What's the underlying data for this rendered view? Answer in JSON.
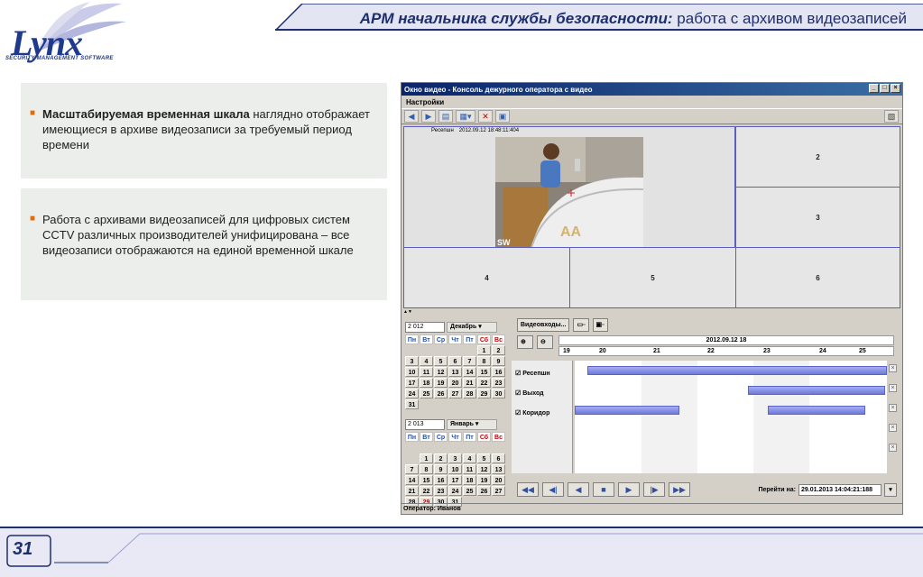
{
  "header": {
    "title_bold": "АРМ начальника службы безопасности:",
    "title_rest": " работа с архивом видеозаписей"
  },
  "logo": {
    "name": "Lynx",
    "tagline": "SECURITY MANAGEMENT SOFTWARE"
  },
  "bullets": {
    "b1_bold": "Масштабируемая временная шкала",
    "b1_rest": " наглядно отображает имеющиеся в архиве видеозаписи за требуемый период времени",
    "b2": "Работа с архивами видеозаписей для цифровых систем CCTV различных производителей унифицирована – все видеозаписи отображаются на  единой временной шкале"
  },
  "window": {
    "title": "Окно видео - Консоль дежурного оператора с видео",
    "menu_settings": "Настройки",
    "cam_name": "Ресепшн",
    "cam_time": "2012.09.12 18:48:11:404",
    "cells": [
      "2",
      "3",
      "4",
      "5",
      "6"
    ],
    "status": "Оператор: Иванов"
  },
  "calendar1": {
    "year": "2 012",
    "month": "Декабрь",
    "headers": [
      "Пн",
      "Вт",
      "Ср",
      "Чт",
      "Пт",
      "Сб",
      "Вс"
    ],
    "days": [
      "",
      "",
      "",
      "",
      "",
      "1",
      "2",
      "3",
      "4",
      "5",
      "6",
      "7",
      "8",
      "9",
      "10",
      "11",
      "12",
      "13",
      "14",
      "15",
      "16",
      "17",
      "18",
      "19",
      "20",
      "21",
      "22",
      "23",
      "24",
      "25",
      "26",
      "27",
      "28",
      "29",
      "30",
      "31"
    ]
  },
  "calendar2": {
    "year": "2 013",
    "month": "Январь",
    "days": [
      "",
      "",
      "",
      "",
      "",
      "",
      "",
      "",
      "1",
      "2",
      "3",
      "4",
      "5",
      "6",
      "7",
      "8",
      "9",
      "10",
      "11",
      "12",
      "13",
      "14",
      "15",
      "16",
      "17",
      "18",
      "19",
      "20",
      "21",
      "22",
      "23",
      "24",
      "25",
      "26",
      "27",
      "28",
      "29",
      "30",
      "31"
    ],
    "highlight": "29"
  },
  "timeline": {
    "video_inputs": "Видеовходы...",
    "date_label": "2012.09.12 18",
    "hours": [
      "19",
      "20",
      "21",
      "22",
      "23",
      "24",
      "25"
    ],
    "channels": [
      "Ресепшн",
      "Выход",
      "Коридор"
    ],
    "goto_label": "Перейти на:",
    "goto_value": "29.01.2013 14:04:21:188"
  },
  "footer": {
    "page": "31"
  }
}
